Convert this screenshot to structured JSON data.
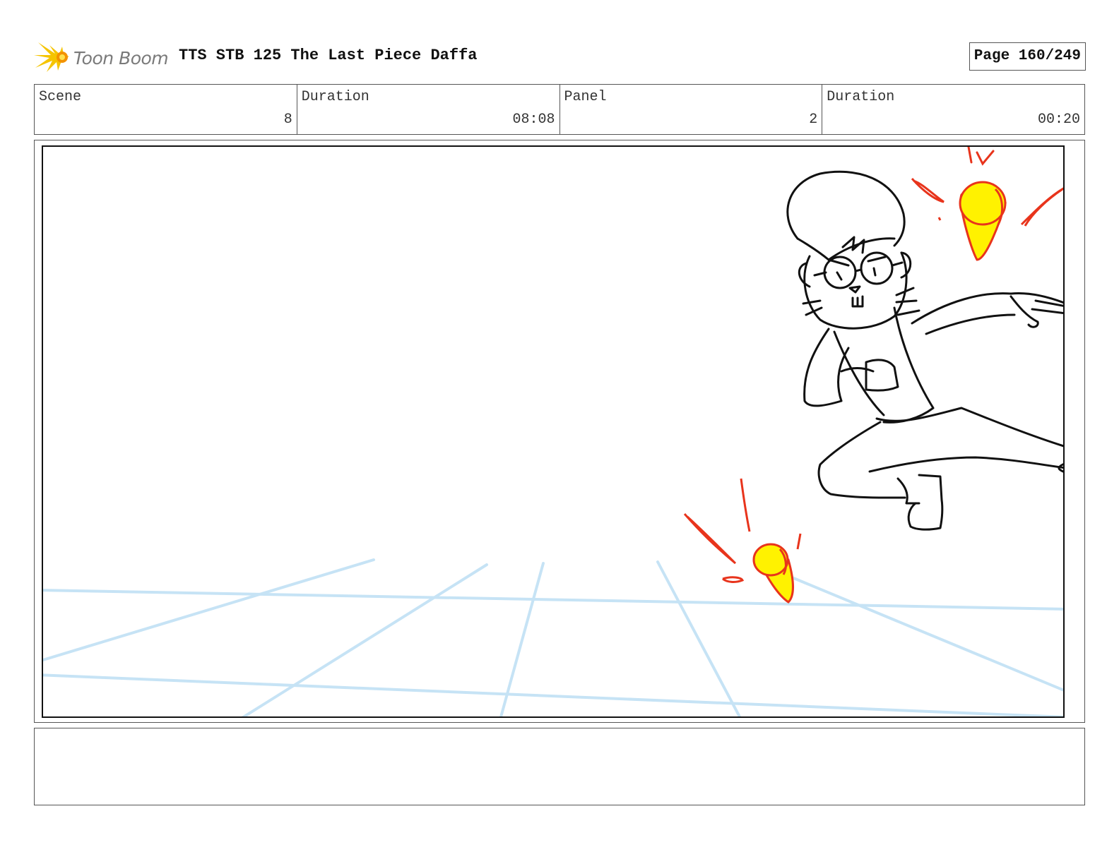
{
  "header": {
    "logo_text": "Toon Boom",
    "title": "TTS STB 125 The Last Piece Daffa",
    "page": "Page 160/249"
  },
  "info": {
    "scene_label": "Scene",
    "scene_value": "8",
    "scene_duration_label": "Duration",
    "scene_duration_value": "08:08",
    "panel_label": "Panel",
    "panel_value": "2",
    "panel_duration_label": "Duration",
    "panel_duration_value": "00:20"
  },
  "notes": {
    "text": ""
  },
  "colors": {
    "logo_yellow": "#f5c400",
    "logo_orange": "#f39200",
    "grid_blue": "#c6e3f5",
    "effect_red": "#e8341c",
    "effect_yellow": "#fff200",
    "ink": "#111111"
  }
}
